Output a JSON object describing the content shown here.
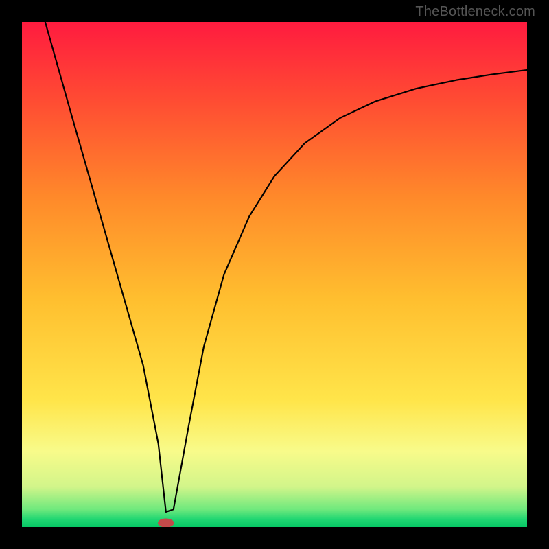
{
  "watermark": "TheBottleneck.com",
  "chart_data": {
    "type": "line",
    "title": "",
    "xlabel": "",
    "ylabel": "",
    "xlim": [
      0,
      100
    ],
    "ylim": [
      0,
      100
    ],
    "grid": false,
    "legend": false,
    "gradient_stops": [
      {
        "offset": 0.0,
        "color": "#ff1b3f"
      },
      {
        "offset": 0.15,
        "color": "#ff4a33"
      },
      {
        "offset": 0.35,
        "color": "#ff8a2a"
      },
      {
        "offset": 0.55,
        "color": "#ffbf2f"
      },
      {
        "offset": 0.75,
        "color": "#ffe54a"
      },
      {
        "offset": 0.85,
        "color": "#f8fb8a"
      },
      {
        "offset": 0.92,
        "color": "#d2f58a"
      },
      {
        "offset": 0.965,
        "color": "#6fe97d"
      },
      {
        "offset": 0.985,
        "color": "#1fd672"
      },
      {
        "offset": 1.0,
        "color": "#07c765"
      }
    ],
    "series": [
      {
        "name": "bottleneck-curve",
        "color": "#000000",
        "x": [
          4.6,
          10,
          15,
          20,
          24,
          27,
          28.5,
          30,
          33,
          36,
          40,
          45,
          50,
          56,
          63,
          70,
          78,
          86,
          93,
          100
        ],
        "y": [
          100,
          80.9,
          63.5,
          46.0,
          32.0,
          16.5,
          3.0,
          3.5,
          20.0,
          35.7,
          50.0,
          61.5,
          69.5,
          76.0,
          81.0,
          84.3,
          86.8,
          88.5,
          89.6,
          90.5
        ]
      }
    ],
    "marker": {
      "name": "optimal-point",
      "x": 28.5,
      "y": 0.8,
      "rx": 1.6,
      "ry": 0.9,
      "color": "#c24a4a"
    }
  }
}
